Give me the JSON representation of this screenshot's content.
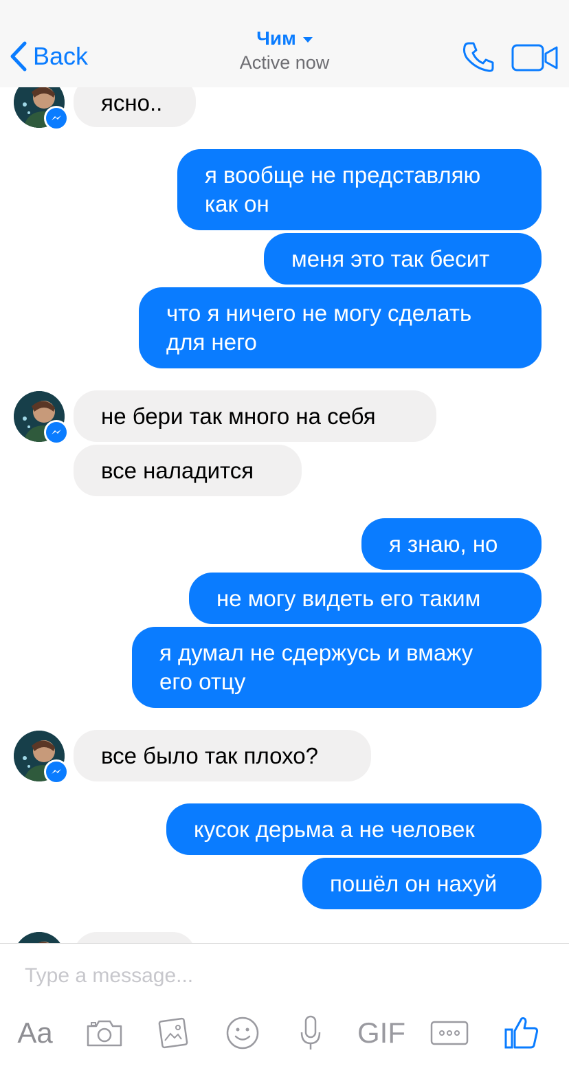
{
  "header": {
    "back_label": "Back",
    "contact_name": "Чим",
    "status": "Active now"
  },
  "messages": [
    {
      "side": "in",
      "text": "ясно.."
    },
    {
      "side": "out",
      "text": "я вообще не представляю\nкак он"
    },
    {
      "side": "out",
      "text": "меня это так бесит"
    },
    {
      "side": "out",
      "text": "что я ничего не могу сделать\nдля него"
    },
    {
      "side": "in",
      "text": "не бери так много на себя"
    },
    {
      "side": "in",
      "text": "все наладится"
    },
    {
      "side": "out",
      "text": "я знаю, но"
    },
    {
      "side": "out",
      "text": "не могу видеть его таким"
    },
    {
      "side": "out",
      "text": "я думал не сдержусь и вмажу\nего отцу"
    },
    {
      "side": "in",
      "text": "все было так плохо?"
    },
    {
      "side": "out",
      "text": "кусок дерьма а не человек"
    },
    {
      "side": "out",
      "text": "пошёл он нахуй"
    }
  ],
  "composer": {
    "placeholder": "Type a message...",
    "text_tool_label": "Aa",
    "gif_label": "GIF"
  },
  "colors": {
    "accent": "#0a7cff",
    "incoming_bubble": "#f1f0f0",
    "header_bg": "#f7f7f7"
  }
}
